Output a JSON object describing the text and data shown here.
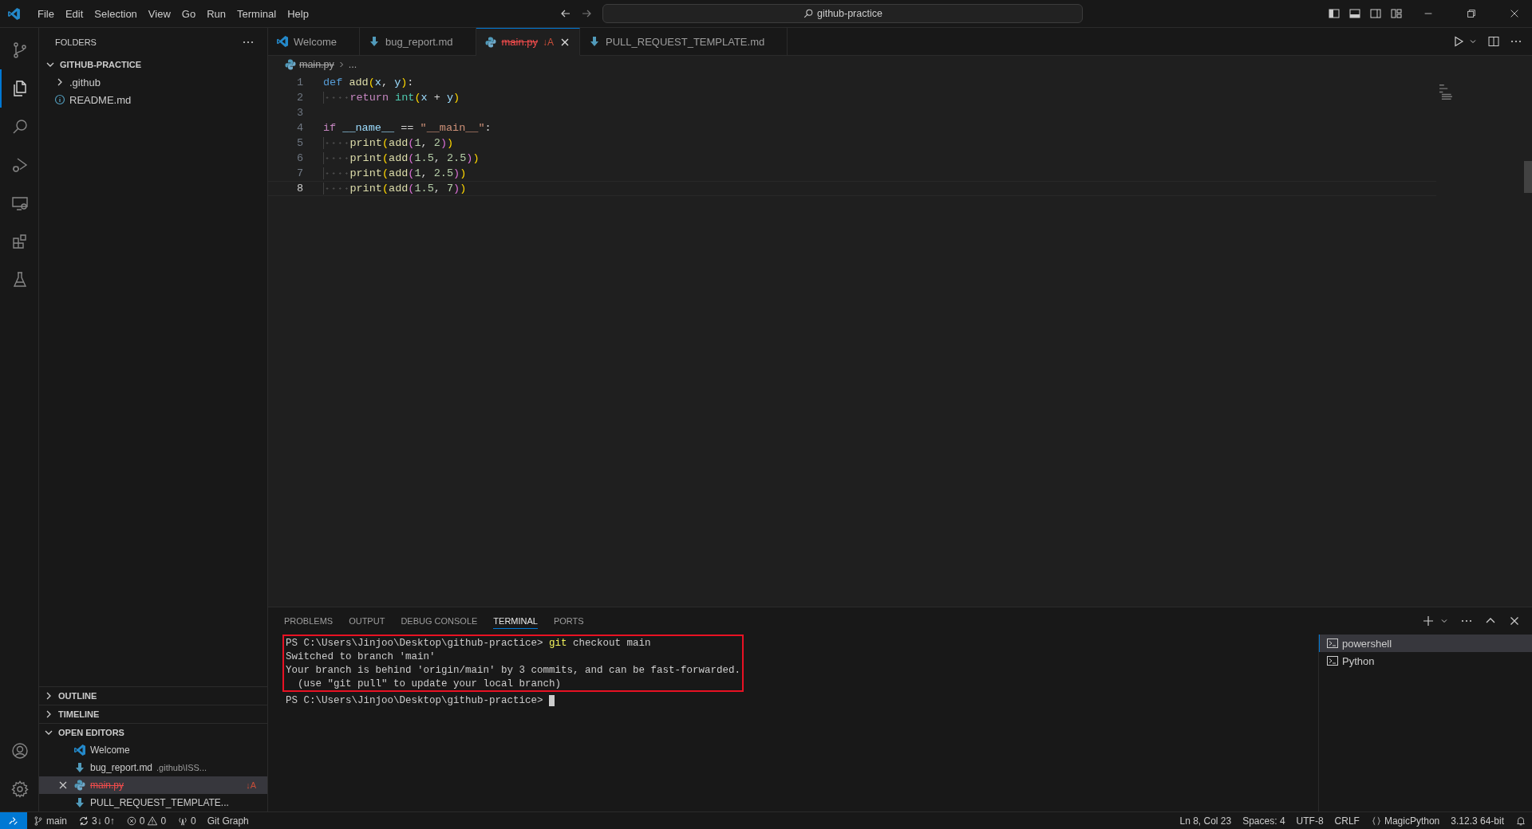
{
  "title_bar": {
    "menu": [
      "File",
      "Edit",
      "Selection",
      "View",
      "Go",
      "Run",
      "Terminal",
      "Help"
    ],
    "search": {
      "value": "github-practice"
    }
  },
  "activity_bar": {
    "top": [
      {
        "kind": "source-control",
        "selected": false
      },
      {
        "kind": "explorer",
        "selected": true
      },
      {
        "kind": "search",
        "selected": false
      },
      {
        "kind": "run-debug",
        "selected": false
      },
      {
        "kind": "remote",
        "selected": false
      },
      {
        "kind": "extensions",
        "selected": false
      },
      {
        "kind": "testing",
        "selected": false
      }
    ],
    "bottom": [
      {
        "kind": "account",
        "selected": false
      },
      {
        "kind": "settings",
        "selected": false
      }
    ]
  },
  "sidebar": {
    "title": "FOLDERS",
    "tree": [
      {
        "label": "GITHUB-PRACTICE",
        "kind": "root",
        "expanded": true,
        "children": [
          {
            "label": ".github",
            "kind": "folder",
            "expanded": false
          },
          {
            "label": "README.md",
            "kind": "info"
          }
        ]
      }
    ],
    "sections": [
      {
        "label": "OUTLINE",
        "expanded": false
      },
      {
        "label": "TIMELINE",
        "expanded": false
      }
    ],
    "open_editors": {
      "label": "OPEN EDITORS",
      "expanded": true,
      "items": [
        {
          "label": "Welcome",
          "kind": "vscode",
          "selected": false,
          "deleted": false
        },
        {
          "label": "bug_report.md",
          "kind": "markdown",
          "description": ".github\\ISS...",
          "selected": false,
          "deleted": false
        },
        {
          "label": "main.py",
          "kind": "python",
          "selected": true,
          "deleted": true,
          "badge": "↓A"
        },
        {
          "label": "PULL_REQUEST_TEMPLATE...",
          "kind": "markdown",
          "selected": false,
          "deleted": false
        }
      ]
    }
  },
  "tabs": [
    {
      "label": "Welcome",
      "kind": "vscode",
      "selected": false,
      "deleted": false
    },
    {
      "label": "bug_report.md",
      "kind": "markdown",
      "selected": false,
      "deleted": false
    },
    {
      "label": "main.py",
      "kind": "python",
      "selected": true,
      "deleted": true,
      "badge": "↓A"
    },
    {
      "label": "PULL_REQUEST_TEMPLATE.md",
      "kind": "markdown",
      "selected": false,
      "deleted": false
    }
  ],
  "breadcrumb": [
    {
      "label": "main.py",
      "kind": "python",
      "deleted": true
    },
    {
      "label": "...",
      "kind": "symbol"
    }
  ],
  "editor": {
    "lines": [
      {
        "number": "1",
        "current": false,
        "tokens": [
          {
            "text": "def",
            "kind": "keyword"
          },
          {
            "text": " add",
            "kind": "function"
          },
          {
            "text": "(",
            "kind": "bracket"
          },
          {
            "text": "x",
            "kind": "variable"
          },
          {
            "text": ",",
            "kind": "operator"
          },
          {
            "text": " y",
            "kind": "variable"
          },
          {
            "text": ")",
            "kind": "bracket"
          },
          {
            "text": ":",
            "kind": "operator"
          }
        ]
      },
      {
        "number": "2",
        "current": false,
        "tokens": [
          {
            "text": "    return",
            "kind": "control"
          },
          {
            "text": " int",
            "kind": "type"
          },
          {
            "text": "(",
            "kind": "bracket"
          },
          {
            "text": "x",
            "kind": "variable"
          },
          {
            "text": " +",
            "kind": "operator"
          },
          {
            "text": " y",
            "kind": "variable"
          },
          {
            "text": ")",
            "kind": "bracket"
          }
        ]
      },
      {
        "number": "3",
        "current": false
      },
      {
        "number": "4",
        "current": false,
        "tokens": [
          {
            "text": "if",
            "kind": "control"
          },
          {
            "text": " __name__",
            "kind": "variable"
          },
          {
            "text": " ==",
            "kind": "operator"
          },
          {
            "text": " \"__main__\"",
            "kind": "string"
          },
          {
            "text": ":",
            "kind": "operator"
          }
        ]
      },
      {
        "number": "5",
        "current": false,
        "tokens": [
          {
            "text": "    print",
            "kind": "function"
          },
          {
            "text": "(",
            "kind": "bracket"
          },
          {
            "text": "add",
            "kind": "function"
          },
          {
            "text": "(",
            "kind": "nested"
          },
          {
            "text": "1",
            "kind": "number"
          },
          {
            "text": ",",
            "kind": "operator"
          },
          {
            "text": " 2",
            "kind": "number"
          },
          {
            "text": ")",
            "kind": "nested"
          },
          {
            "text": ")",
            "kind": "bracket"
          }
        ]
      },
      {
        "number": "6",
        "current": false,
        "tokens": [
          {
            "text": "    print",
            "kind": "function"
          },
          {
            "text": "(",
            "kind": "bracket"
          },
          {
            "text": "add",
            "kind": "function"
          },
          {
            "text": "(",
            "kind": "nested"
          },
          {
            "text": "1.5",
            "kind": "number"
          },
          {
            "text": ",",
            "kind": "operator"
          },
          {
            "text": " 2.5",
            "kind": "number"
          },
          {
            "text": ")",
            "kind": "nested"
          },
          {
            "text": ")",
            "kind": "bracket"
          }
        ]
      },
      {
        "number": "7",
        "current": false,
        "tokens": [
          {
            "text": "    print",
            "kind": "function"
          },
          {
            "text": "(",
            "kind": "bracket"
          },
          {
            "text": "add",
            "kind": "function"
          },
          {
            "text": "(",
            "kind": "nested"
          },
          {
            "text": "1",
            "kind": "number"
          },
          {
            "text": ",",
            "kind": "operator"
          },
          {
            "text": " 2.5",
            "kind": "number"
          },
          {
            "text": ")",
            "kind": "nested"
          },
          {
            "text": ")",
            "kind": "bracket"
          }
        ]
      },
      {
        "number": "8",
        "current": true,
        "tokens": [
          {
            "text": "    print",
            "kind": "function"
          },
          {
            "text": "(",
            "kind": "bracket"
          },
          {
            "text": "add",
            "kind": "function"
          },
          {
            "text": "(",
            "kind": "nested"
          },
          {
            "text": "1.5",
            "kind": "number"
          },
          {
            "text": ",",
            "kind": "operator"
          },
          {
            "text": " 7",
            "kind": "number"
          },
          {
            "text": ")",
            "kind": "nested"
          },
          {
            "text": ")",
            "kind": "bracket"
          }
        ]
      }
    ]
  },
  "panel": {
    "tabs": [
      {
        "label": "PROBLEMS",
        "selected": false
      },
      {
        "label": "OUTPUT",
        "selected": false
      },
      {
        "label": "DEBUG CONSOLE",
        "selected": false
      },
      {
        "label": "TERMINAL",
        "selected": true
      },
      {
        "label": "PORTS",
        "selected": false
      }
    ],
    "terminal": {
      "blocks": [
        {
          "highlighted": true,
          "lines": [
            [
              {
                "text": "PS C:\\Users\\Jinjoo\\Desktop\\github-practice>",
                "kind": "plain"
              },
              {
                "text": " git",
                "kind": "command"
              },
              {
                "text": " checkout main",
                "kind": "plain"
              }
            ],
            [
              {
                "text": "Switched to branch 'main'",
                "kind": "plain"
              }
            ],
            [
              {
                "text": "Your branch is behind 'origin/main' by 3 commits, and can be fast-forwarded.",
                "kind": "plain"
              }
            ],
            [
              {
                "text": "  (use \"git pull\" to update your local branch)",
                "kind": "plain"
              }
            ]
          ]
        },
        {
          "highlighted": false,
          "cursor": true,
          "lines": [
            [
              {
                "text": "PS C:\\Users\\Jinjoo\\Desktop\\github-practice>",
                "kind": "plain"
              }
            ]
          ]
        }
      ]
    },
    "sessions": [
      {
        "label": "powershell",
        "selected": true
      },
      {
        "label": "Python",
        "selected": false
      }
    ]
  },
  "status_bar": {
    "left": [
      {
        "kind": "remote"
      },
      {
        "kind": "branch",
        "text": "main"
      },
      {
        "kind": "sync",
        "text": "3↓ 0↑"
      },
      {
        "kind": "problems",
        "errors": "0",
        "warnings": "0"
      },
      {
        "kind": "ports",
        "text": "0"
      },
      {
        "kind": "plain",
        "text": "Git Graph"
      }
    ],
    "right": [
      {
        "kind": "plain",
        "text": "Ln 8, Col 23"
      },
      {
        "kind": "plain",
        "text": "Spaces: 4"
      },
      {
        "kind": "plain",
        "text": "UTF-8"
      },
      {
        "kind": "plain",
        "text": "CRLF"
      },
      {
        "kind": "language",
        "text": "MagicPython"
      },
      {
        "kind": "plain",
        "text": "3.12.3 64-bit"
      },
      {
        "kind": "bell"
      }
    ]
  }
}
